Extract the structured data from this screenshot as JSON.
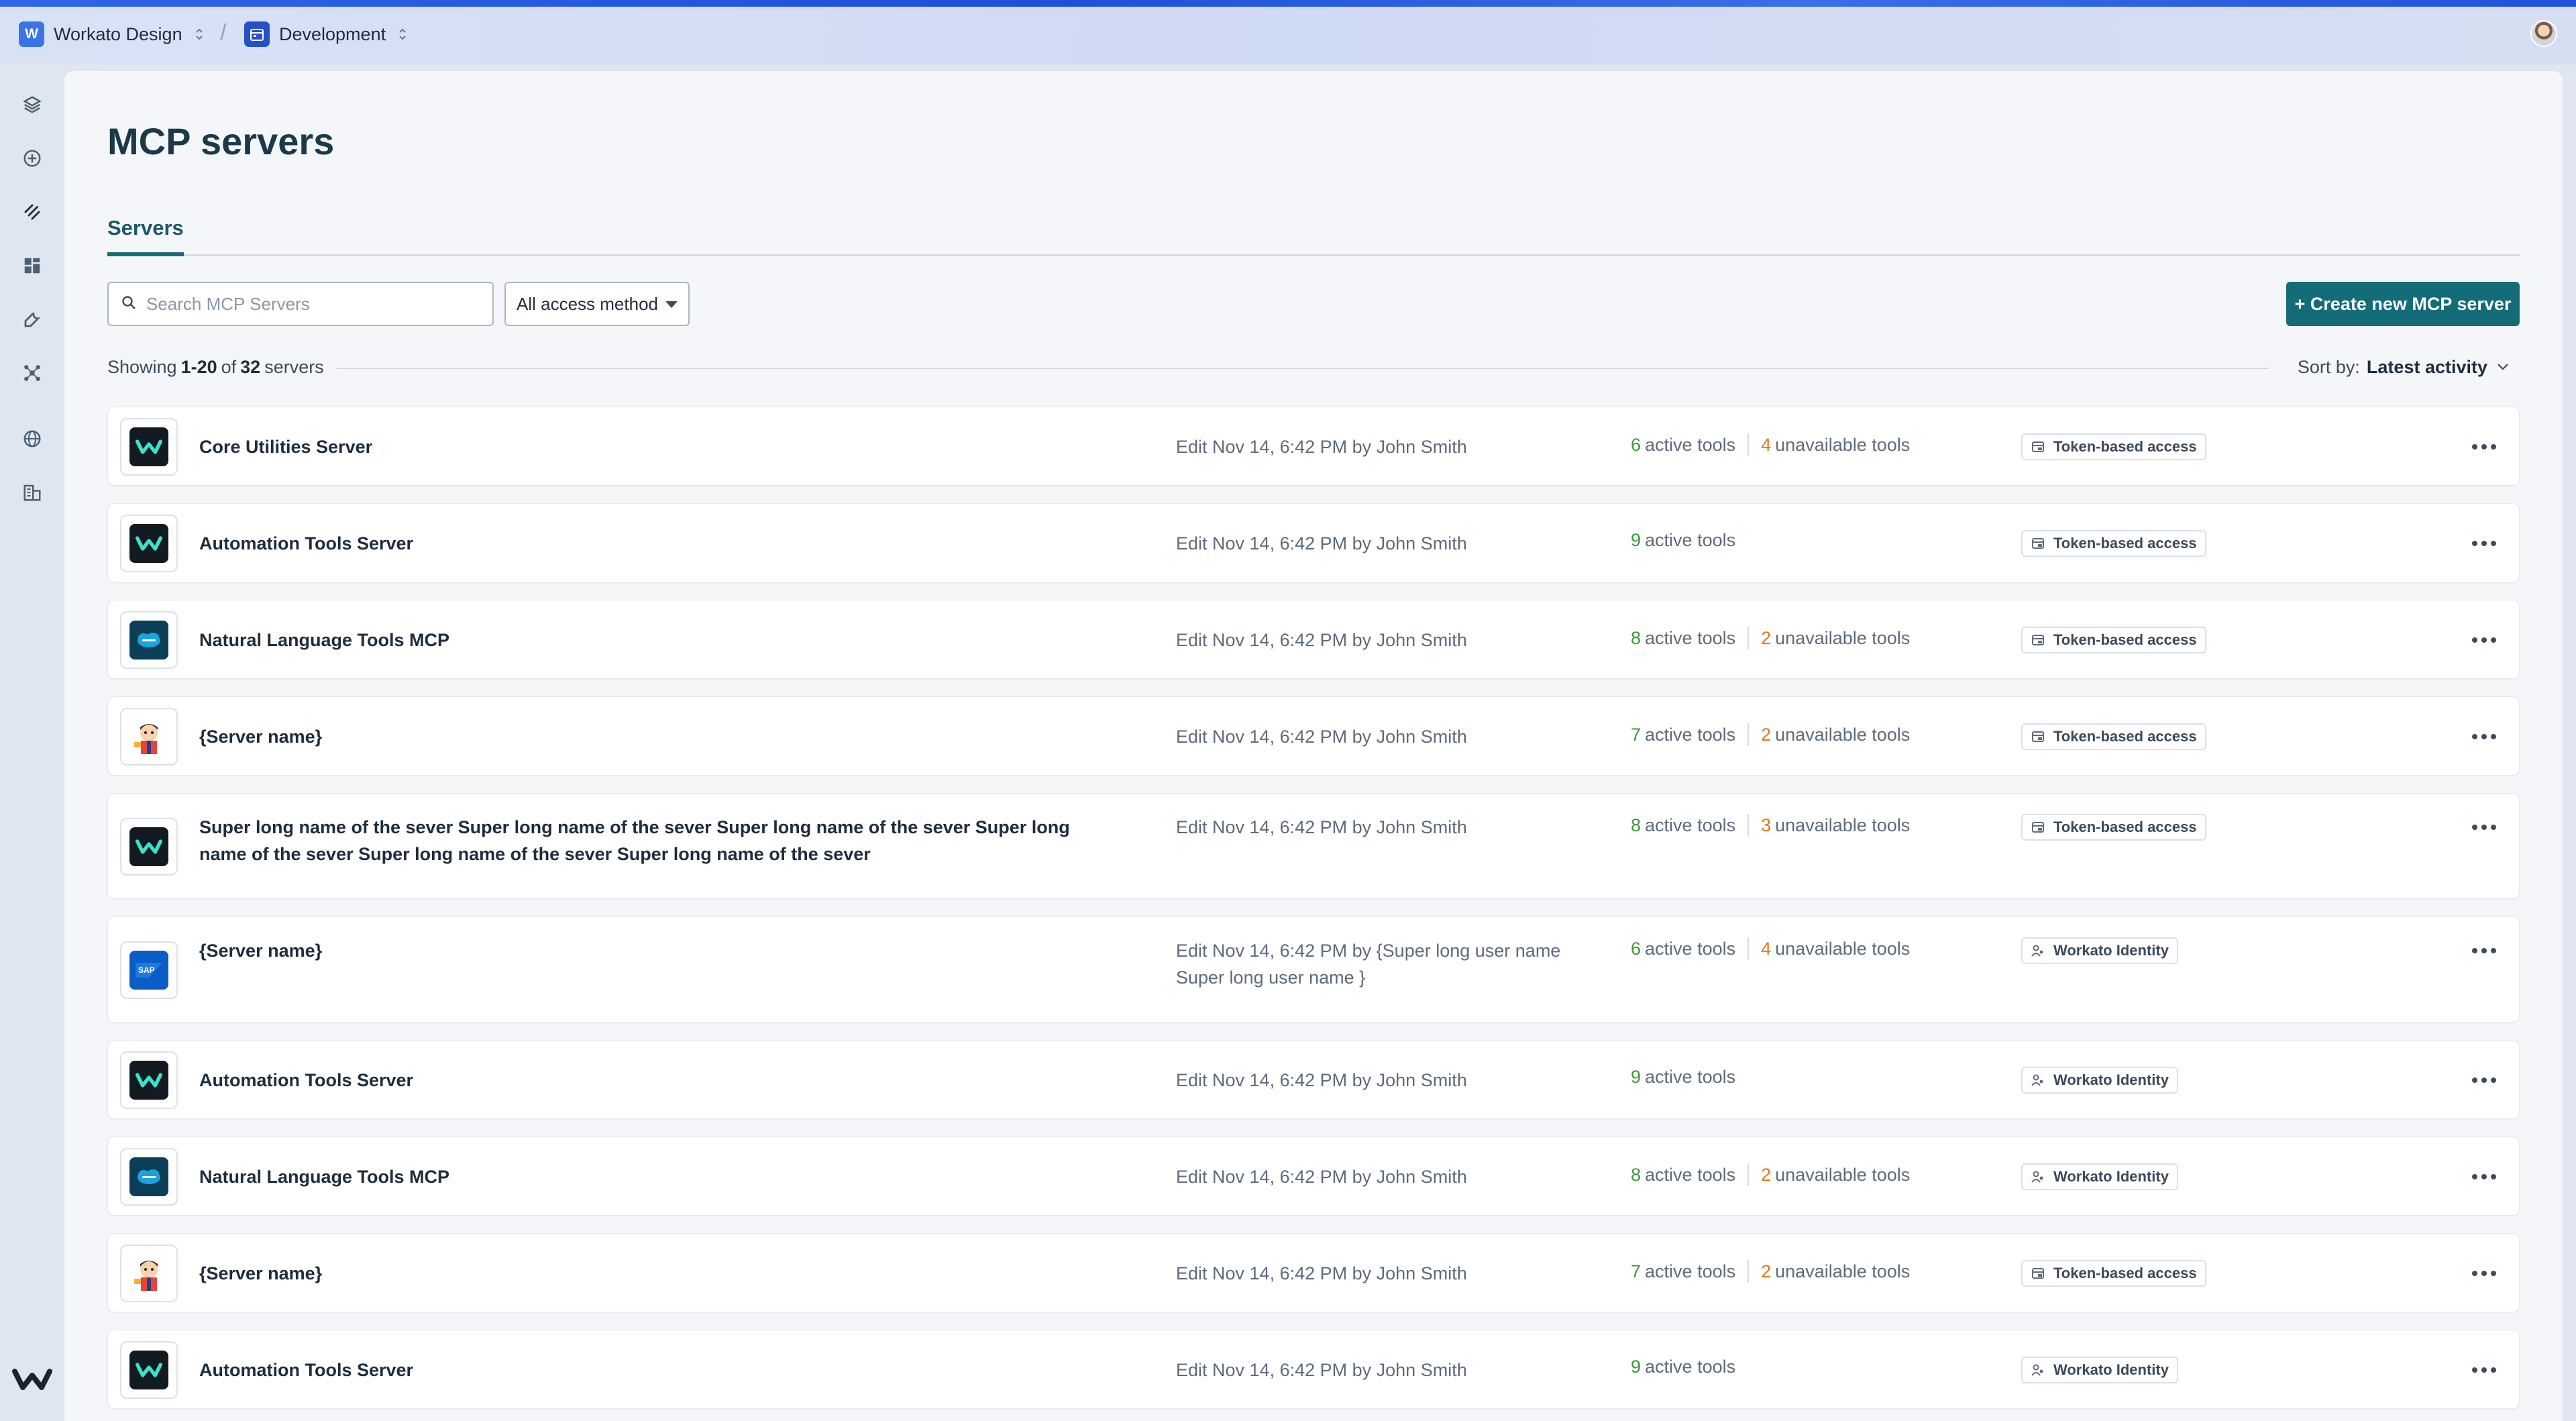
{
  "topbar": {
    "workspace": {
      "initial": "W",
      "name": "Workato Design"
    },
    "environment": {
      "name": "Development"
    }
  },
  "page": {
    "title": "MCP servers",
    "tabs": [
      {
        "label": "Servers"
      }
    ]
  },
  "toolbar": {
    "search_placeholder": "Search MCP Servers",
    "filter_value": "All access method",
    "create_label": "+ Create new MCP server"
  },
  "summary": {
    "prefix": "Showing",
    "range": "1-20",
    "of": "of",
    "total": "32",
    "suffix": "servers",
    "sort_label": "Sort by:",
    "sort_value": "Latest activity"
  },
  "colors": {
    "accent": "#136c77",
    "active_tools": "#3a9a3a",
    "unavailable_tools": "#e4761e"
  },
  "servers": [
    {
      "logo": "workato-logo-icon",
      "name": "Core Utilities Server",
      "edit": "Edit Nov 14, 6:42 PM by John Smith",
      "active": "6",
      "active_label": "active tools",
      "unavailable": "4",
      "unavailable_label": "unavailable tools",
      "access_icon": "token-icon",
      "access": "Token-based access"
    },
    {
      "logo": "workato-logo-icon",
      "name": "Automation Tools Server",
      "edit": "Edit Nov 14, 6:42 PM by John Smith",
      "active": "9",
      "active_label": "active tools",
      "unavailable": "",
      "unavailable_label": "",
      "access_icon": "token-icon",
      "access": "Token-based access"
    },
    {
      "logo": "salesforce-logo-icon",
      "name": "Natural Language Tools MCP",
      "edit": "Edit Nov 14, 6:42 PM by John Smith",
      "active": "8",
      "active_label": "active tools",
      "unavailable": "2",
      "unavailable_label": "unavailable tools",
      "access_icon": "token-icon",
      "access": "Token-based access"
    },
    {
      "logo": "mascot-avatar-icon",
      "name": "{Server name}",
      "edit": "Edit Nov 14, 6:42 PM by John Smith",
      "active": "7",
      "active_label": "active tools",
      "unavailable": "2",
      "unavailable_label": "unavailable tools",
      "access_icon": "token-icon",
      "access": "Token-based access"
    },
    {
      "logo": "workato-logo-icon",
      "name": "Super long name of the sever Super long name of the sever Super long name of the sever Super long name of the sever Super long name of the sever Super long name of the sever",
      "edit": "Edit Nov 14, 6:42 PM by John Smith",
      "active": "8",
      "active_label": "active tools",
      "unavailable": "3",
      "unavailable_label": "unavailable tools",
      "access_icon": "token-icon",
      "access": "Token-based access"
    },
    {
      "logo": "sap-logo-icon",
      "name": "{Server name}",
      "edit": "Edit Nov 14, 6:42 PM by {Super long user name Super long user name }",
      "active": "6",
      "active_label": "active tools",
      "unavailable": "4",
      "unavailable_label": "unavailable tools",
      "access_icon": "identity-icon",
      "access": "Workato Identity"
    },
    {
      "logo": "workato-logo-icon",
      "name": "Automation Tools Server",
      "edit": "Edit Nov 14, 6:42 PM by John Smith",
      "active": "9",
      "active_label": "active tools",
      "unavailable": "",
      "unavailable_label": "",
      "access_icon": "identity-icon",
      "access": "Workato Identity"
    },
    {
      "logo": "salesforce-logo-icon",
      "name": "Natural Language Tools MCP",
      "edit": "Edit Nov 14, 6:42 PM by John Smith",
      "active": "8",
      "active_label": "active tools",
      "unavailable": "2",
      "unavailable_label": "unavailable tools",
      "access_icon": "identity-icon",
      "access": "Workato Identity"
    },
    {
      "logo": "mascot-avatar-icon",
      "name": "{Server name}",
      "edit": "Edit Nov 14, 6:42 PM by John Smith",
      "active": "7",
      "active_label": "active tools",
      "unavailable": "2",
      "unavailable_label": "unavailable tools",
      "access_icon": "token-icon",
      "access": "Token-based access"
    },
    {
      "logo": "workato-logo-icon",
      "name": "Automation Tools Server",
      "edit": "Edit Nov 14, 6:42 PM by John Smith",
      "active": "9",
      "active_label": "active tools",
      "unavailable": "",
      "unavailable_label": "",
      "access_icon": "identity-icon",
      "access": "Workato Identity"
    }
  ]
}
